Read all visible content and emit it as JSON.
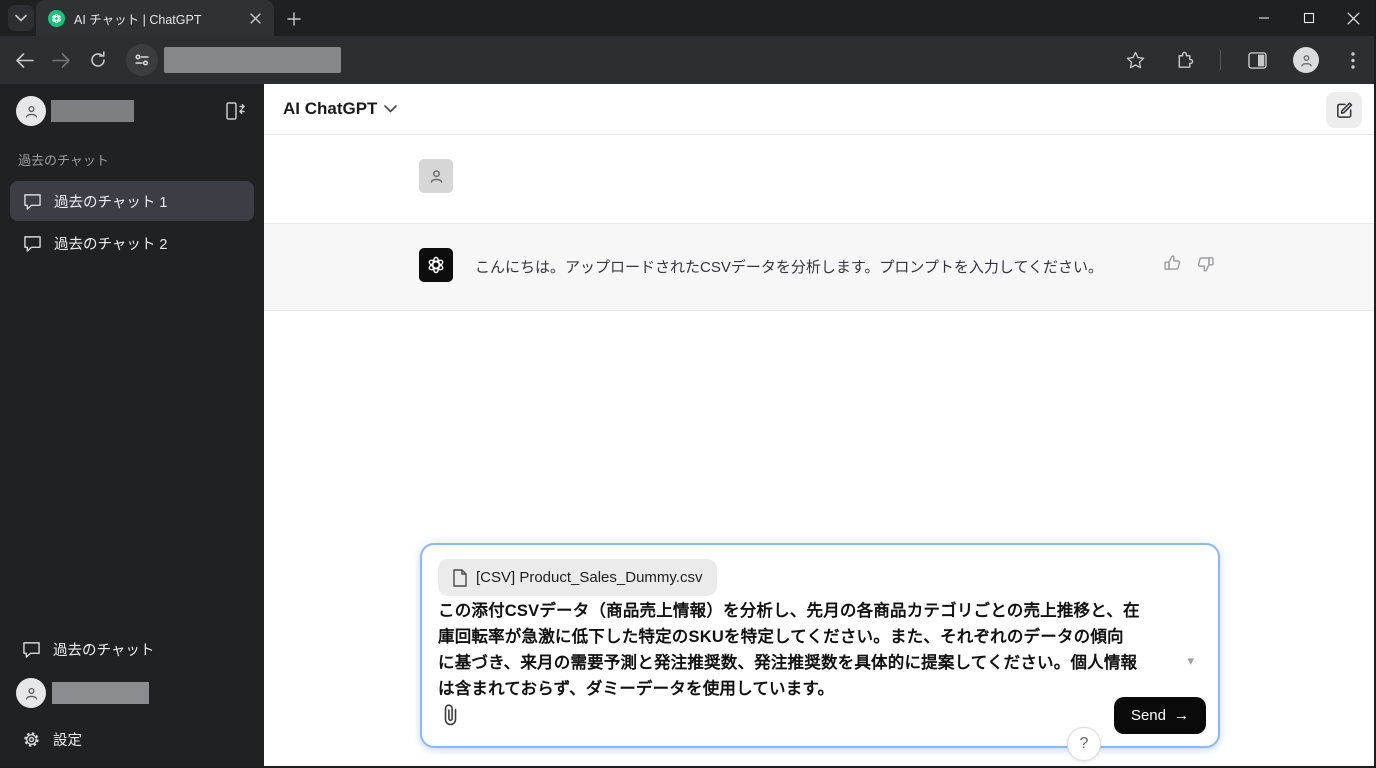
{
  "browser": {
    "tab_title": "AI チャット | ChatGPT"
  },
  "sidebar": {
    "history_label": "過去のチャット",
    "items": [
      {
        "label": "過去のチャット 1",
        "active": true
      },
      {
        "label": "過去のチャット 2",
        "active": false
      }
    ],
    "footer": {
      "history_label": "過去のチャット",
      "settings_label": "設定"
    }
  },
  "header": {
    "title": "AI ChatGPT"
  },
  "chat": {
    "assistant_message": "こんにちは。アップロードされたCSVデータを分析します。プロンプトを入力してください。"
  },
  "composer": {
    "attachment_label": "[CSV] Product_Sales_Dummy.csv",
    "prompt_text": "この添付CSVデータ（商品売上情報）を分析し、先月の各商品カテゴリごとの売上推移と、在庫回転率が急激に低下した特定のSKUを特定してください。また、それぞれのデータの傾向に基づき、来月の需要予測と発注推奨数、発注推奨数を具体的に提案してください。個人情報は含まれておらず、ダミーデータを使用しています。",
    "caret_glyph": "▾",
    "send_label": "Send",
    "send_arrow": "→"
  },
  "help_label": "?",
  "colors": {
    "accent_border": "#8db8f5",
    "favicon_green": "#19c37d",
    "sidebar_bg": "#202123",
    "sidebar_active_item": "#3c3e46",
    "assistant_row_bg": "#f7f7f8",
    "send_button_bg": "#0a0a0a"
  }
}
